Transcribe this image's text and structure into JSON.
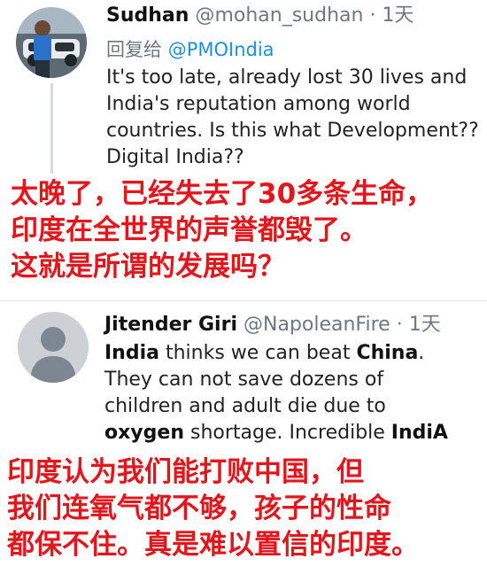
{
  "tweet1": {
    "author_name": "Sudhan",
    "author_handle": "@mohan_sudhan",
    "separator": "·",
    "time": "1天",
    "reply_label": "回复给",
    "reply_handle": "@PMOIndia",
    "body_lines": [
      "It's too late, already lost 30 lives and",
      "India's reputation among world",
      "countries. Is this what Development??",
      "Digital India??"
    ],
    "caption_lines": [
      "太晚了，已经失去了30多条生命，",
      "印度在全世界的声誉都毁了。",
      "这就是所谓的发展吗？"
    ]
  },
  "tweet2": {
    "author_name": "Jitender Giri",
    "author_handle": "@NapoleanFire",
    "separator": "·",
    "time": "1天",
    "body": {
      "line1_a": "India",
      "line1_b": " thinks we  can beat ",
      "line1_c": "China",
      "line1_d": ".",
      "line2": "They can not save dozens of",
      "line3": "children and adult die due to",
      "line4_a": "oxygen",
      "line4_b": " shortage.  Incredible ",
      "line4_c": "IndiA"
    },
    "caption_lines": [
      "印度认为我们能打败中国，但",
      "我们连氧气都不够，孩子的性命",
      "都保不住。真是难以置信的印度。"
    ]
  },
  "colors": {
    "caption": "#e5161b",
    "link": "#1d8fe0",
    "muted": "#6b7882",
    "avatar_placeholder": "#cdd1d6"
  }
}
